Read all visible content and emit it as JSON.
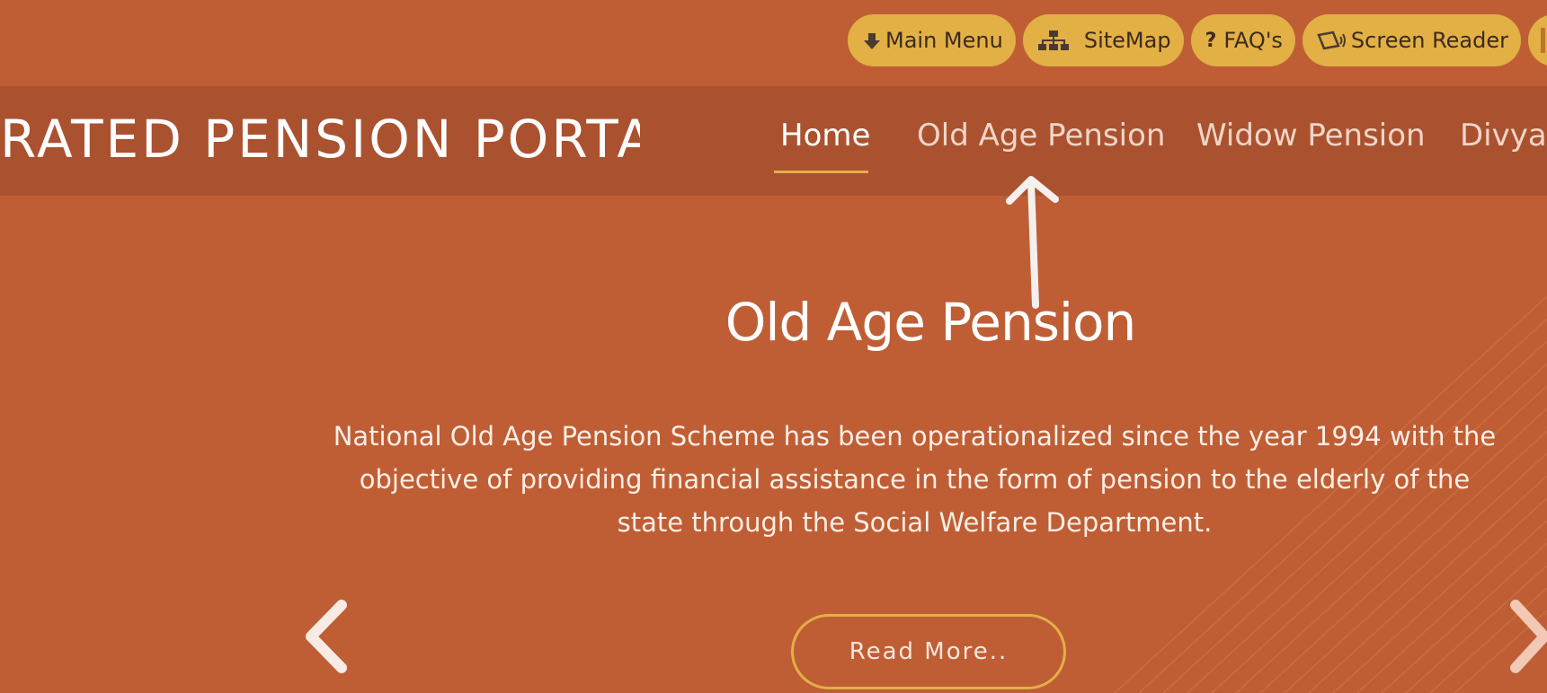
{
  "utility_bar": {
    "main_menu": "Main Menu",
    "sitemap": "SiteMap",
    "faqs": "FAQ's",
    "screen_reader": "Screen Reader"
  },
  "header": {
    "portal_title": "RATED PENSION PORTAL"
  },
  "nav": {
    "items": [
      {
        "label": "Home",
        "active": true
      },
      {
        "label": "Old Age Pension",
        "active": false
      },
      {
        "label": "Widow Pension",
        "active": false
      },
      {
        "label": "Divyan",
        "active": false
      }
    ]
  },
  "hero": {
    "title": "Old Age Pension",
    "description": "National Old Age Pension Scheme has been operationalized since the year 1994 with the objective of providing financial assistance in the form of pension to the elderly of the state through the Social Welfare Department.",
    "read_more": "Read More.."
  },
  "icons": {
    "main_menu": "down-arrow-icon",
    "sitemap": "sitemap-icon",
    "faqs": "question-icon",
    "screen_reader": "screen-reader-icon",
    "carousel_prev": "chevron-left-icon",
    "carousel_next": "chevron-right-icon",
    "annotation": "arrow-up-icon"
  },
  "colors": {
    "background": "#bf5e35",
    "nav_band": "#aa522f",
    "accent": "#e2b045"
  }
}
